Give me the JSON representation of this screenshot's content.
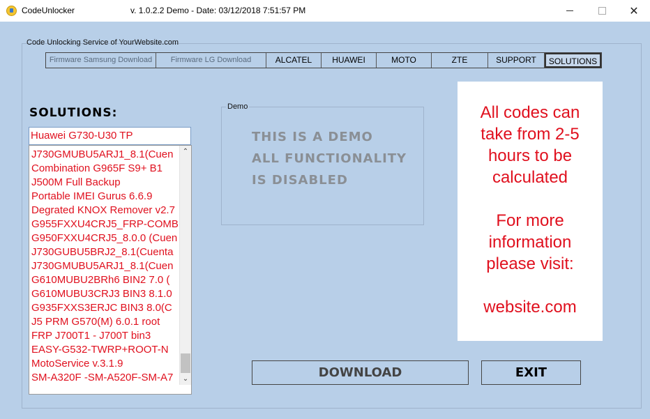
{
  "window": {
    "title": "CodeUnlocker",
    "version_text": "v. 1.0.2.2 Demo - Date: 03/12/2018 7:51:57 PM"
  },
  "group_label": "Code Unlocking Service of YourWebsite.com",
  "tabs": [
    {
      "label": "Firmware Samsung Download",
      "kind": "firmware"
    },
    {
      "label": "Firmware LG Download",
      "kind": "firmware"
    },
    {
      "label": "ALCATEL",
      "kind": "normal"
    },
    {
      "label": "HUAWEI",
      "kind": "normal"
    },
    {
      "label": "MOTO",
      "kind": "normal"
    },
    {
      "label": "ZTE",
      "kind": "normal"
    },
    {
      "label": "SUPPORT",
      "kind": "normal"
    },
    {
      "label": "SOLUTIONS",
      "kind": "active"
    }
  ],
  "solutions": {
    "heading": "SOLUTIONS:",
    "selected_value": "Huawei G730-U30 TP",
    "items": [
      "J730GMUBU5ARJ1_8.1(Cuen",
      "Combination G965F S9+ B1",
      "J500M Full Backup",
      "Portable IMEI Gurus 6.6.9",
      "Degrated KNOX Remover v2.7",
      "G955FXXU4CRJ5_FRP-COMB",
      "G950FXXU4CRJ5_8.0.0 (Cuen",
      "J730GUBU5BRJ2_8.1(Cuenta",
      "J730GMUBU5ARJ1_8.1(Cuen",
      "G610MUBU2BRh6 BIN2 7.0 (",
      "G610MUBU3CRJ3 BIN3 8.1.0",
      "G935FXXS3ERJC BIN3 8.0(C",
      "J5 PRM G570(M) 6.0.1 root",
      "FRP J700T1 - J700T bin3",
      "EASY-G532-TWRP+ROOT-N",
      "MotoService v.3.1.9",
      "SM-A320F -SM-A520F-SM-A7"
    ]
  },
  "demo": {
    "label": "Demo",
    "line1": "THIS IS A DEMO",
    "line2": "ALL FUNCTIONALITY",
    "line3": "IS DISABLED"
  },
  "info": {
    "lines": [
      "All codes can",
      "take from 2-5",
      "hours to be",
      "calculated",
      "",
      "For more",
      "information",
      "please visit:",
      "",
      "website.com"
    ],
    "color": "#e0101e"
  },
  "buttons": {
    "download": "DOWNLOAD",
    "exit": "EXIT"
  },
  "icons": {
    "app": "app-icon",
    "scroll_up": "chevron-up-icon",
    "scroll_down": "chevron-down-icon"
  }
}
